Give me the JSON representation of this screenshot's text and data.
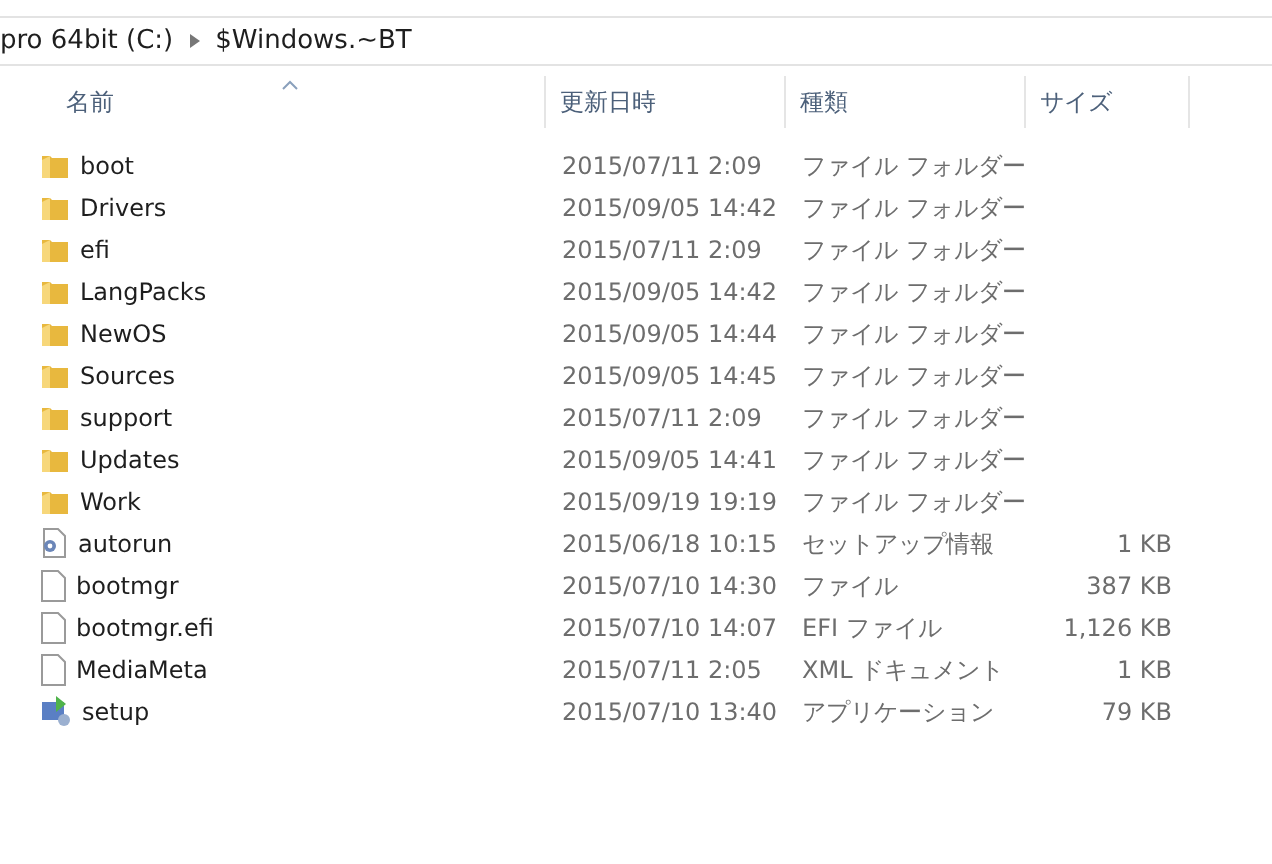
{
  "address_bar": {
    "segments": [
      "pro 64bit (C:)",
      "$Windows.~BT"
    ]
  },
  "columns": [
    {
      "label": "名前",
      "sorted": true
    },
    {
      "label": "更新日時",
      "sorted": false
    },
    {
      "label": "種類",
      "sorted": false
    },
    {
      "label": "サイズ",
      "sorted": false
    }
  ],
  "rows": [
    {
      "kind": "folder",
      "name": "boot",
      "modified": "2015/07/11 2:09",
      "type": "ファイル フォルダー"
    },
    {
      "kind": "folder",
      "name": "Drivers",
      "modified": "2015/09/05 14:42",
      "type": "ファイル フォルダー"
    },
    {
      "kind": "folder",
      "name": "efi",
      "modified": "2015/07/11 2:09",
      "type": "ファイル フォルダー"
    },
    {
      "kind": "folder",
      "name": "LangPacks",
      "modified": "2015/09/05 14:42",
      "type": "ファイル フォルダー"
    },
    {
      "kind": "folder",
      "name": "NewOS",
      "modified": "2015/09/05 14:44",
      "type": "ファイル フォルダー"
    },
    {
      "kind": "folder",
      "name": "Sources",
      "modified": "2015/09/05 14:45",
      "type": "ファイル フォルダー"
    },
    {
      "kind": "folder",
      "name": "support",
      "modified": "2015/07/11 2:09",
      "type": "ファイル フォルダー"
    },
    {
      "kind": "folder",
      "name": "Updates",
      "modified": "2015/09/05 14:41",
      "type": "ファイル フォルダー"
    },
    {
      "kind": "folder",
      "name": "Work",
      "modified": "2015/09/19 19:19",
      "type": "ファイル フォルダー"
    },
    {
      "kind": "settings",
      "name": "autorun",
      "modified": "2015/06/18 10:15",
      "type": "セットアップ情報",
      "size": "1 KB"
    },
    {
      "kind": "file",
      "name": "bootmgr",
      "modified": "2015/07/10 14:30",
      "type": "ファイル",
      "size": "387 KB"
    },
    {
      "kind": "file",
      "name": "bootmgr.efi",
      "modified": "2015/07/10 14:07",
      "type": "EFI ファイル",
      "size": "1,126 KB"
    },
    {
      "kind": "file",
      "name": "MediaMeta",
      "modified": "2015/07/11 2:05",
      "type": "XML ドキュメント",
      "size": "1 KB"
    },
    {
      "kind": "app",
      "name": "setup",
      "modified": "2015/07/10 13:40",
      "type": "アプリケーション",
      "size": "79 KB"
    }
  ]
}
